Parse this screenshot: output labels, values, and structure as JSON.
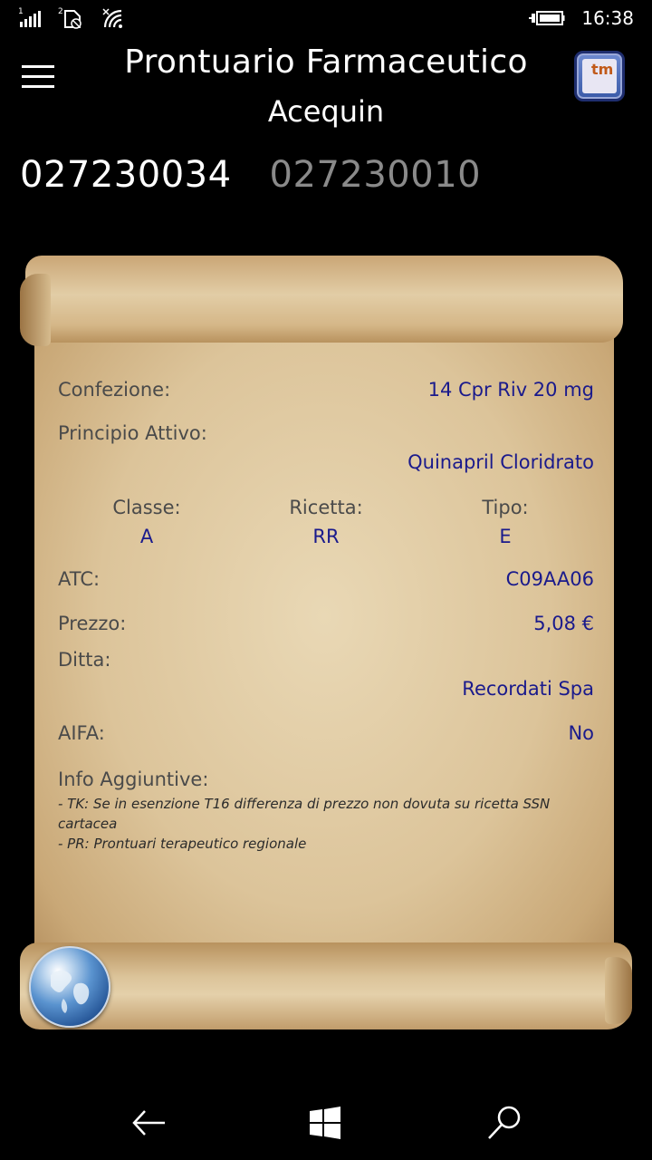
{
  "status_bar": {
    "sim1_label": "1",
    "sim2_label": "2",
    "time": "16:38"
  },
  "header": {
    "title": "Prontuario Farmaceutico",
    "subtitle": "Acequin",
    "logo_text": "tm"
  },
  "pivot": [
    {
      "label": "027230034",
      "active": true
    },
    {
      "label": "027230010",
      "active": false
    }
  ],
  "details": {
    "confezione_label": "Confezione:",
    "confezione_value": "14 Cpr Riv 20 mg",
    "principio_label": "Principio Attivo:",
    "principio_value": "Quinapril Cloridrato",
    "classe_label": "Classe:",
    "classe_value": "A",
    "ricetta_label": "Ricetta:",
    "ricetta_value": "RR",
    "tipo_label": "Tipo:",
    "tipo_value": "E",
    "atc_label": "ATC:",
    "atc_value": "C09AA06",
    "prezzo_label": "Prezzo:",
    "prezzo_value": "5,08 €",
    "ditta_label": "Ditta:",
    "ditta_value": "Recordati Spa",
    "aifa_label": "AIFA:",
    "aifa_value": "No",
    "info_label": "Info Aggiuntive:",
    "info_lines": [
      " - TK: Se in esenzione T16 differenza di prezzo non dovuta su ricetta SSN cartacea",
      " - PR: Prontuari terapeutico regionale"
    ]
  },
  "colors": {
    "value_blue": "#1a1a8c",
    "label_gray": "#4a4a4a",
    "background": "#000000"
  },
  "icons": {
    "menu": "hamburger-icon",
    "globe": "globe-icon",
    "back": "back-arrow-icon",
    "windows": "windows-logo-icon",
    "search": "search-icon"
  }
}
